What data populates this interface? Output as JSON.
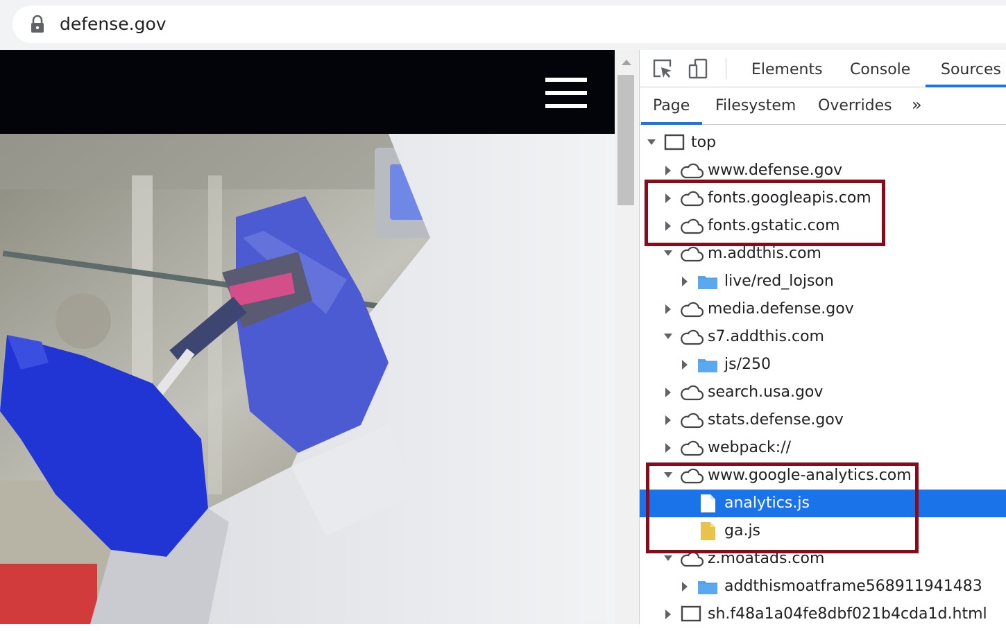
{
  "address_bar": {
    "url": "defense.gov",
    "icon": "lock-icon"
  },
  "page": {
    "menu_icon": "hamburger-icon",
    "hero_image": "laboratory-pipette-photo"
  },
  "devtools": {
    "toolbar": {
      "inspect_icon": "inspect-element-icon",
      "device_icon": "device-toolbar-icon",
      "tabs": [
        "Elements",
        "Console",
        "Sources"
      ],
      "active_tab": "Sources"
    },
    "sources_nav": {
      "tabs": [
        "Page",
        "Filesystem",
        "Overrides"
      ],
      "more": "»",
      "active_tab": "Page"
    },
    "tree": [
      {
        "label": "top",
        "icon": "frame-icon",
        "expanded": true
      },
      {
        "label": "www.defense.gov",
        "icon": "cloud-icon",
        "expanded": false
      },
      {
        "label": "fonts.googleapis.com",
        "icon": "cloud-icon",
        "expanded": false,
        "highlighted": true
      },
      {
        "label": "fonts.gstatic.com",
        "icon": "cloud-icon",
        "expanded": false,
        "highlighted": true
      },
      {
        "label": "m.addthis.com",
        "icon": "cloud-icon",
        "expanded": true
      },
      {
        "label": "live/red_lojson",
        "icon": "folder-icon",
        "expanded": false
      },
      {
        "label": "media.defense.gov",
        "icon": "cloud-icon",
        "expanded": false
      },
      {
        "label": "s7.addthis.com",
        "icon": "cloud-icon",
        "expanded": true
      },
      {
        "label": "js/250",
        "icon": "folder-icon",
        "expanded": false
      },
      {
        "label": "search.usa.gov",
        "icon": "cloud-icon",
        "expanded": false
      },
      {
        "label": "stats.defense.gov",
        "icon": "cloud-icon",
        "expanded": false
      },
      {
        "label": "webpack://",
        "icon": "cloud-icon",
        "expanded": false
      },
      {
        "label": "www.google-analytics.com",
        "icon": "cloud-icon",
        "expanded": true,
        "highlighted": true
      },
      {
        "label": "analytics.js",
        "icon": "file-icon",
        "selected": true,
        "highlighted": true
      },
      {
        "label": "ga.js",
        "icon": "script-file-icon",
        "highlighted": true
      },
      {
        "label": "z.moatads.com",
        "icon": "cloud-icon",
        "expanded": true
      },
      {
        "label": "addthismoatframe568911941483",
        "icon": "folder-icon",
        "expanded": false
      },
      {
        "label": "sh.f48a1a04fe8dbf021b4cda1d.html",
        "icon": "frame-icon",
        "expanded": false
      }
    ]
  },
  "colors": {
    "highlight_box": "#8b0a1a",
    "selection": "#1a73e8",
    "folder": "#5aa9f0",
    "script_file": "#e8c24a"
  }
}
